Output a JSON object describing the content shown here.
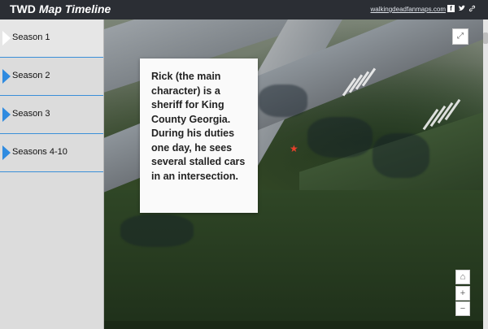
{
  "header": {
    "title_part1": "TWD",
    "title_part2": "Map Timeline",
    "site_link": "walkingdeadfanmaps.com",
    "icons": [
      "facebook-icon",
      "twitter-icon",
      "link-icon"
    ]
  },
  "sidebar": {
    "items": [
      {
        "label": "Season 1"
      },
      {
        "label": "Season 2"
      },
      {
        "label": "Season 3"
      },
      {
        "label": "Seasons 4-10"
      }
    ]
  },
  "map": {
    "info_text": "Rick (the main character) is a sheriff for King County Georgia. During his duties one day, he sees several stalled cars in an intersection.",
    "controls": {
      "expand": "expand-icon",
      "home": "home-icon",
      "zoom_in": "+",
      "zoom_out": "−"
    }
  },
  "colors": {
    "header_bg": "#2b2e34",
    "sidebar_bg": "#dcdcdc",
    "accent": "#2f8be0",
    "pin": "#e8402b"
  }
}
